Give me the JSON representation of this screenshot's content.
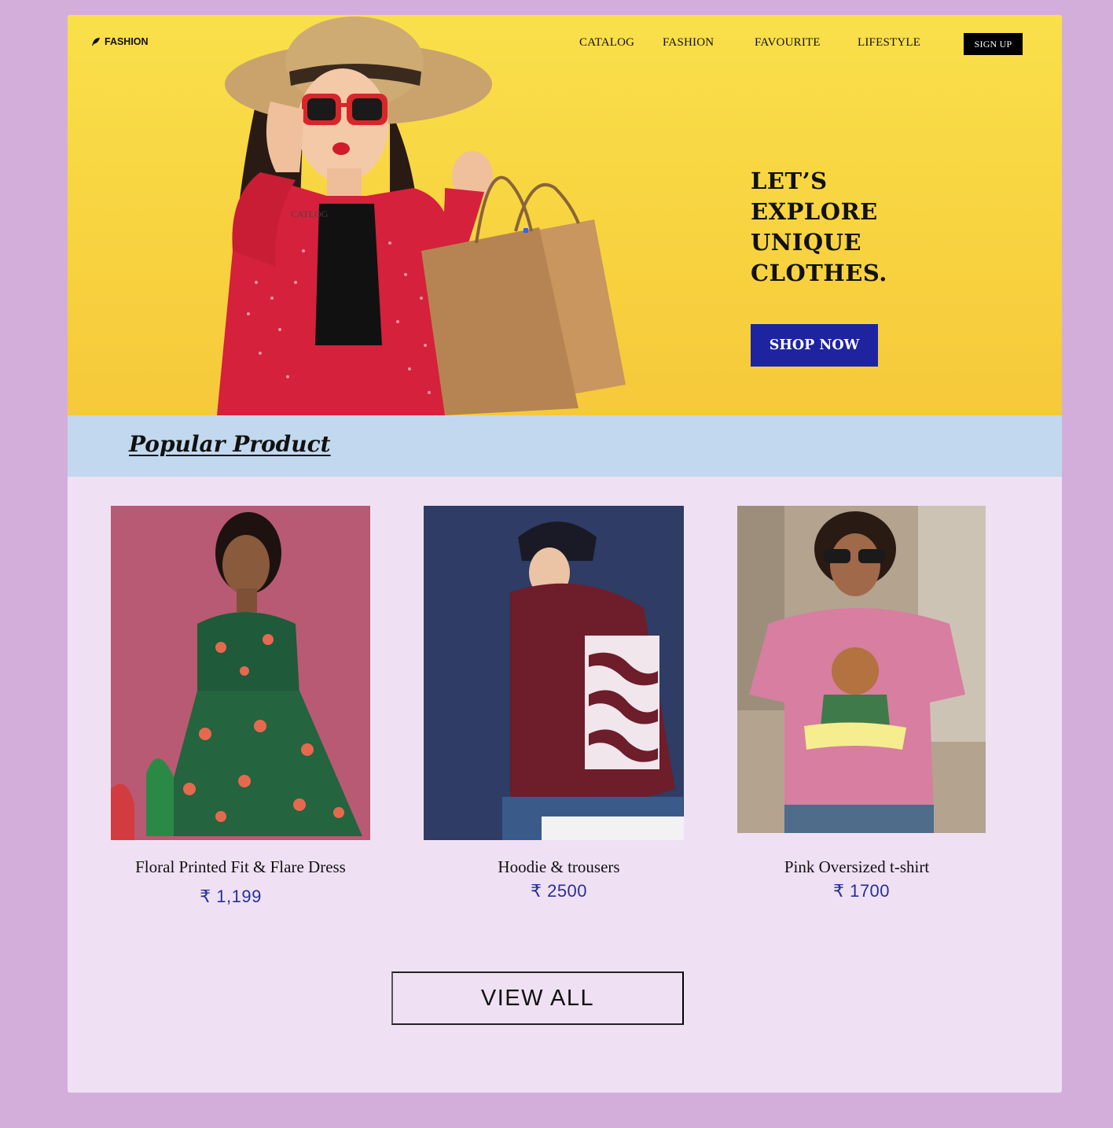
{
  "brand": {
    "name": "FASHION",
    "icon": "feather-icon"
  },
  "nav": {
    "items": [
      "CATALOG",
      "FASHION",
      "FAVOURITE",
      "LIFESTYLE"
    ],
    "signup_label": "SIGN UP"
  },
  "hero": {
    "headline": [
      "LET’S",
      "EXPLORE",
      "UNIQUE",
      "CLOTHES."
    ],
    "cta_label": "SHOP NOW",
    "stray_label": "CATLOG",
    "background_color": "#f8d842"
  },
  "popular": {
    "title": "Popular Product",
    "products": [
      {
        "name": "Floral Printed Fit & Flare Dress",
        "price": "₹ 1,199"
      },
      {
        "name": "Hoodie & trousers",
        "price": "₹ 2500"
      },
      {
        "name": "Pink Oversized t-shirt",
        "price": "₹ 1700"
      }
    ],
    "view_all_label": "VIEW ALL"
  },
  "colors": {
    "page_bg": "#d3aedb",
    "content_bg": "#efe1f3",
    "band_bg": "#c2d8ee",
    "cta_bg": "#1e24a0",
    "price_color": "#27309a"
  }
}
